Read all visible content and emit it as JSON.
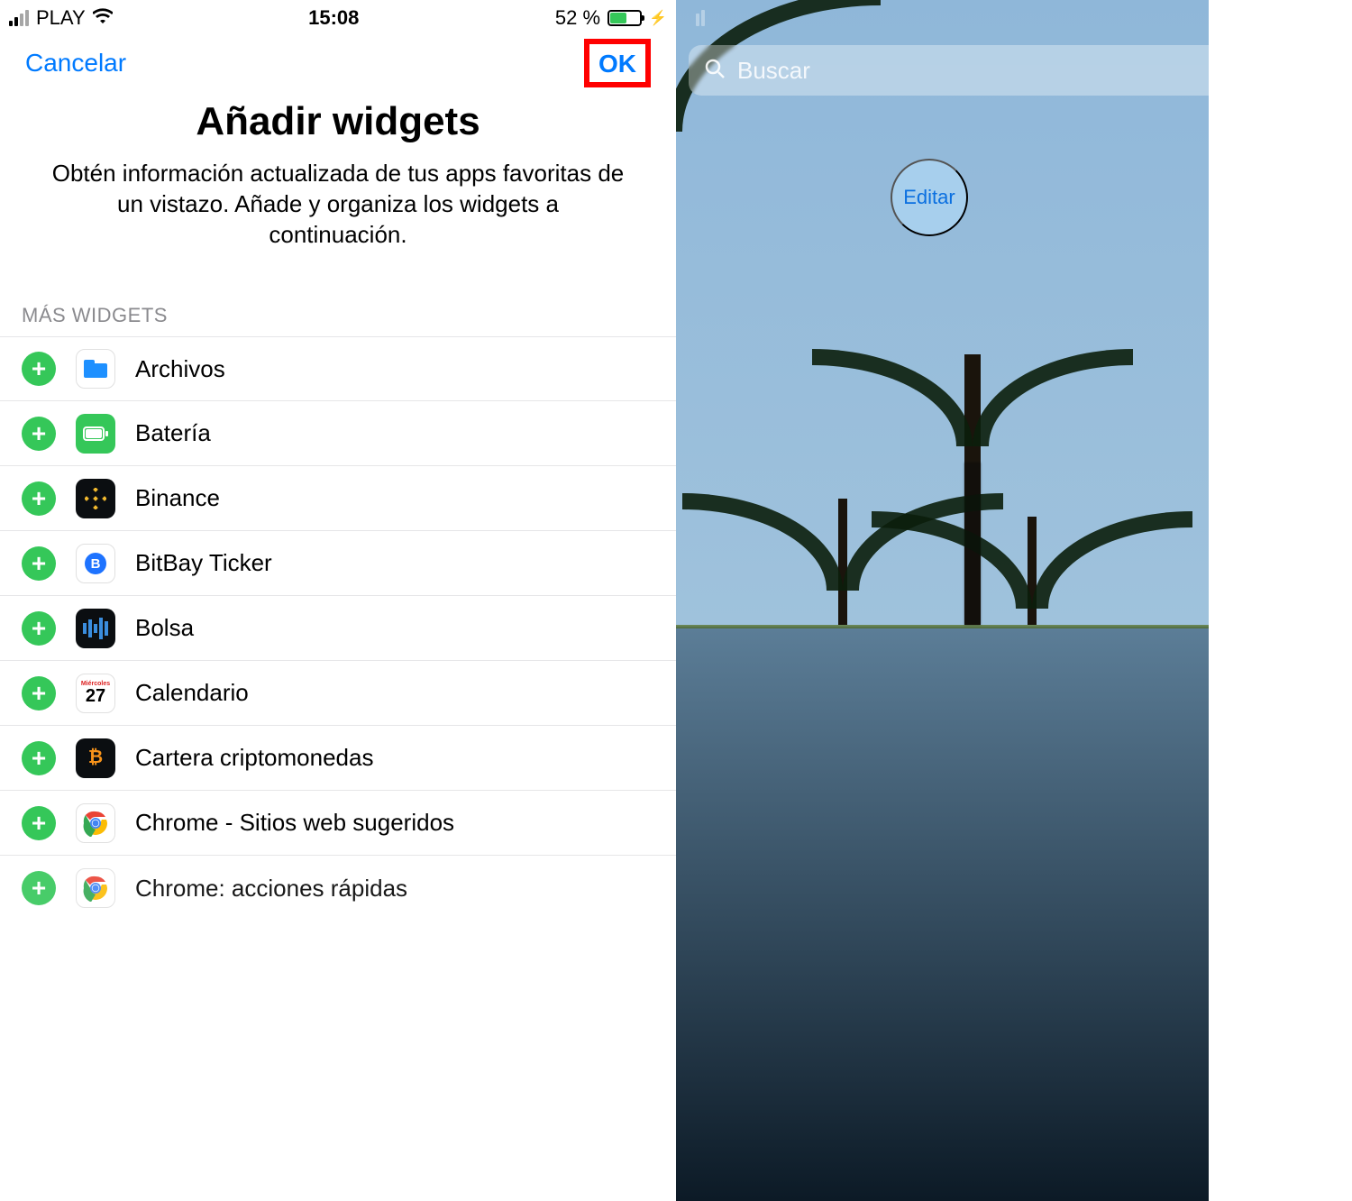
{
  "status": {
    "carrier": "PLAY",
    "time": "15:08",
    "battery_text": "52 %",
    "battery_pct": 52
  },
  "left": {
    "cancel": "Cancelar",
    "ok": "OK",
    "title": "Añadir widgets",
    "subtitle": "Obtén información actualizada de tus apps favoritas de un vistazo. Añade y organiza los widgets a continuación.",
    "section": "MÁS WIDGETS",
    "widgets": [
      {
        "name": "Archivos",
        "icon": "files-icon"
      },
      {
        "name": "Batería",
        "icon": "battery-icon"
      },
      {
        "name": "Binance",
        "icon": "binance-icon"
      },
      {
        "name": "BitBay Ticker",
        "icon": "bitbay-icon"
      },
      {
        "name": "Bolsa",
        "icon": "stocks-icon"
      },
      {
        "name": "Calendario",
        "icon": "calendar-icon",
        "cal_day": "27",
        "cal_wd": "Miércoles"
      },
      {
        "name": "Cartera criptomonedas",
        "icon": "bitcoin-icon"
      },
      {
        "name": "Chrome - Sitios web sugeridos",
        "icon": "chrome-icon"
      },
      {
        "name": "Chrome: acciones rápidas",
        "icon": "chrome-icon"
      }
    ]
  },
  "right": {
    "search_placeholder": "Buscar",
    "edit": "Editar"
  },
  "colors": {
    "ios_blue": "#007aff",
    "ios_green": "#35c759",
    "highlight_red": "#ff0000"
  }
}
